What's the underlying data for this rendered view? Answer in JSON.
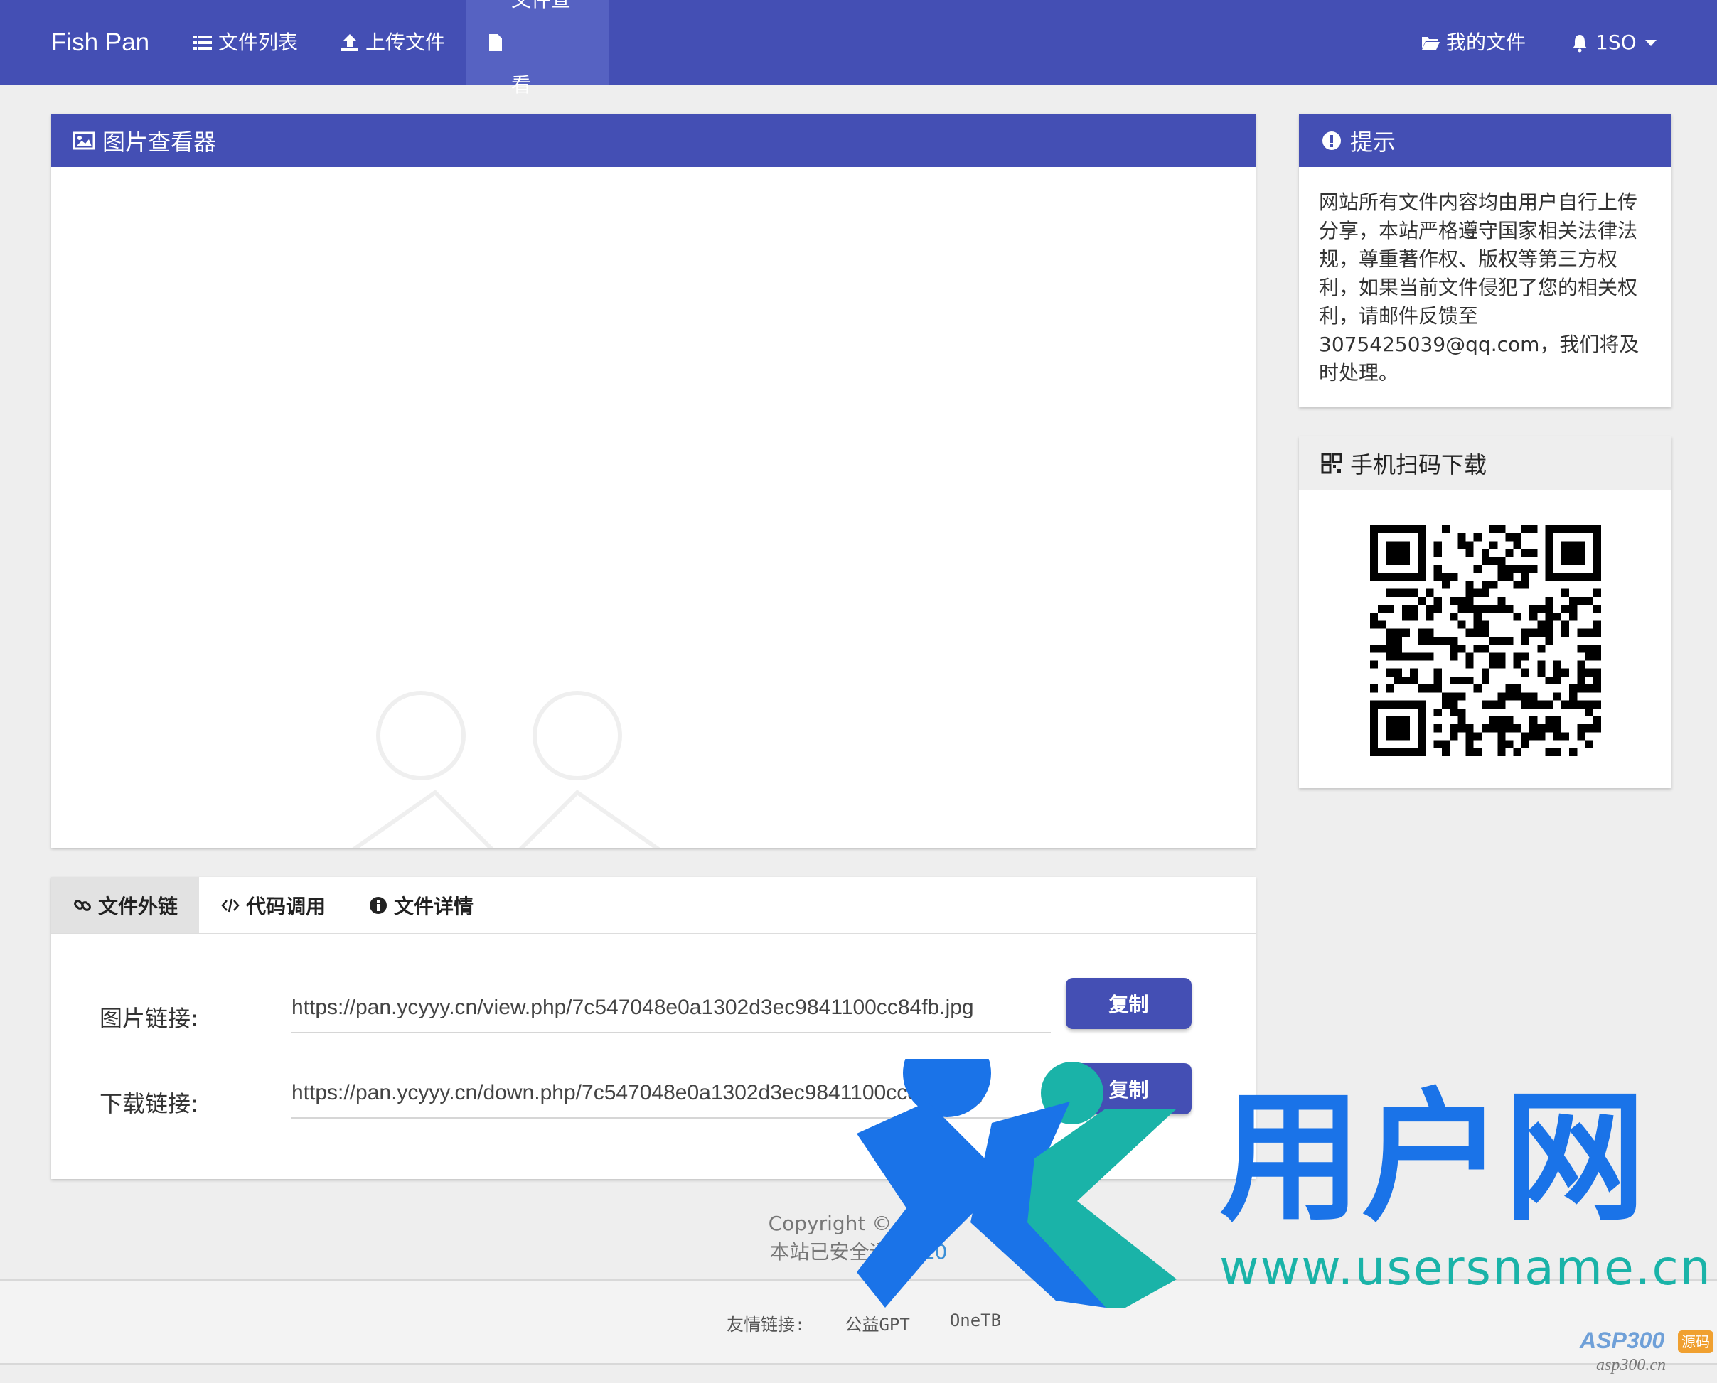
{
  "navbar": {
    "brand": "Fish Pan",
    "items": [
      {
        "label": "文件列表",
        "icon": "list-icon"
      },
      {
        "label": "上传文件",
        "icon": "upload-icon"
      },
      {
        "label": "文件查看",
        "icon": "file-icon",
        "active": true
      }
    ],
    "right": [
      {
        "label": "我的文件",
        "icon": "folder-open-icon"
      },
      {
        "label": "1SO",
        "icon": "bell-icon"
      }
    ]
  },
  "viewer": {
    "title": "图片查看器",
    "icon": "image-icon"
  },
  "notice": {
    "title": "提示",
    "icon": "exclamation-circle-icon",
    "text": "网站所有文件内容均由用户自行上传分享，本站严格遵守国家相关法律法规，尊重著作权、版权等第三方权利，如果当前文件侵犯了您的相关权利，请邮件反馈至3075425039@qq.com，我们将及时处理。"
  },
  "qrcode": {
    "title": "手机扫码下载",
    "icon": "qrcode-icon"
  },
  "tabs": [
    {
      "label": "文件外链",
      "icon": "link-icon",
      "active": true
    },
    {
      "label": "代码调用",
      "icon": "code-icon"
    },
    {
      "label": "文件详情",
      "icon": "info-circle-icon"
    }
  ],
  "links": {
    "image_label": "图片链接:",
    "image_url": "https://pan.ycyyy.cn/view.php/7c547048e0a1302d3ec9841100cc84fb.jpg",
    "download_label": "下载链接:",
    "download_url": "https://pan.ycyyy.cn/down.php/7c547048e0a1302d3ec9841100cc84fb.jpg",
    "copy_label": "复制"
  },
  "footer": {
    "copyright": "Copyright © 2024",
    "runtime_prefix": "本站已安全运行:",
    "runtime_value": "10",
    "friend_label": "友情链接:",
    "friend_links": [
      "公益GPT",
      "OneTB"
    ]
  },
  "watermark": {
    "title": "用户网",
    "site": "www.usersname.cn",
    "asp_mark": "ASP300",
    "asp_tag": "源码",
    "asp_url": "asp300.cn"
  },
  "colors": {
    "primary": "#444fb4",
    "link": "#3b8fd6",
    "wm_blue": "#1a73e8",
    "wm_teal": "#1ab3a8"
  }
}
